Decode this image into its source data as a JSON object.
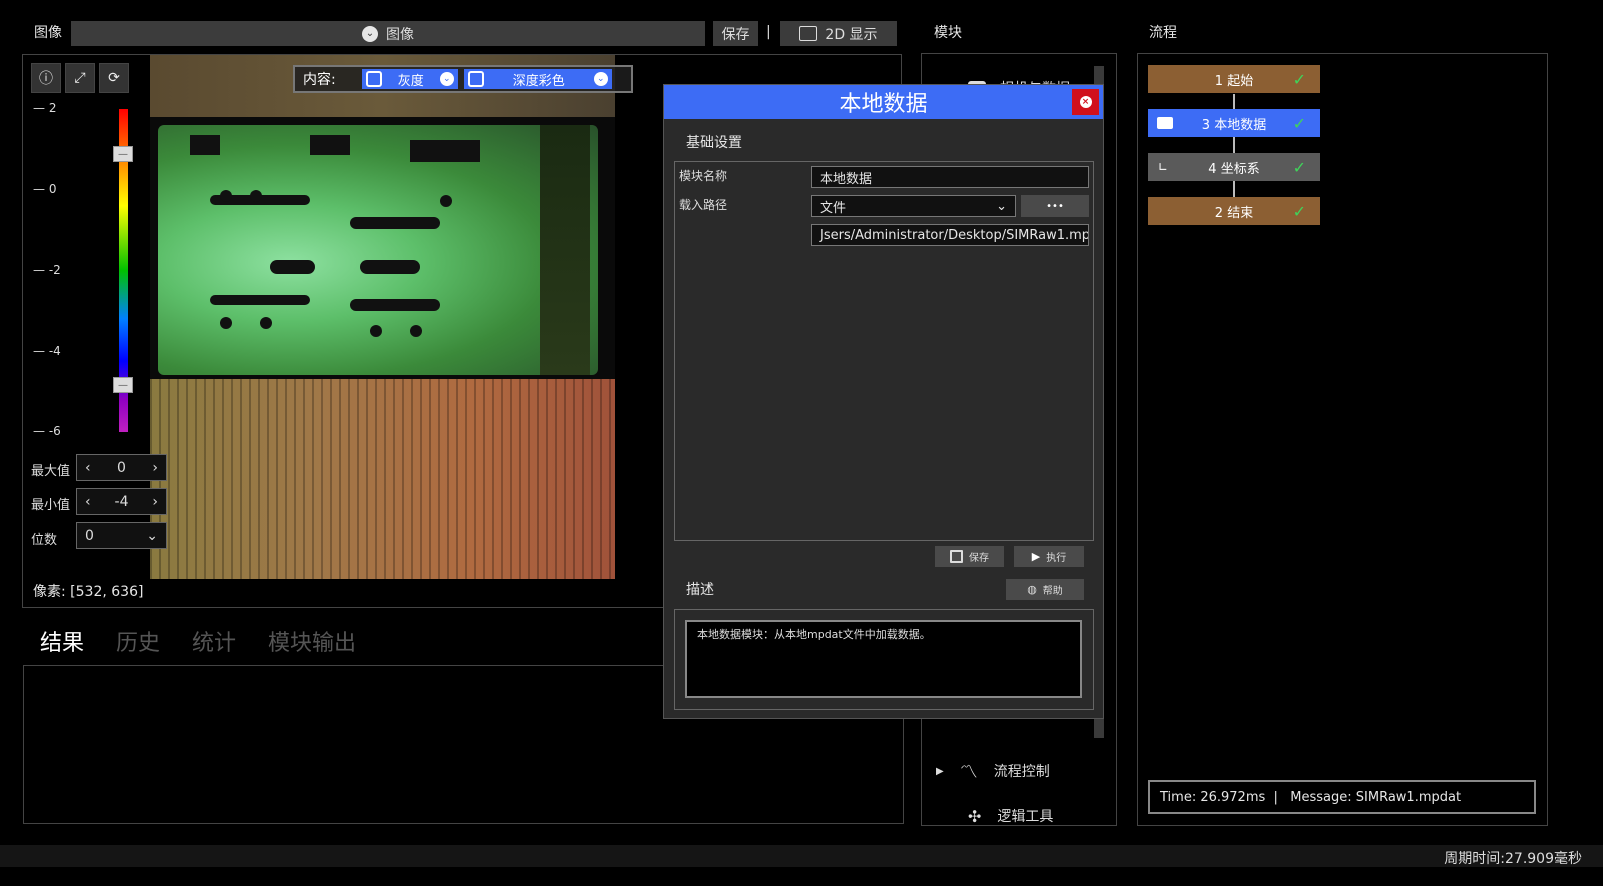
{
  "image_panel": {
    "title": "图像",
    "selector_value": "图像",
    "save_label": "保存",
    "separator": "|",
    "display_label": "2D 显示",
    "content_label": "内容:",
    "gray_label": "灰度",
    "depth_color_label": "深度彩色",
    "scale_ticks": [
      "2",
      "0",
      "-2",
      "-4",
      "-6"
    ],
    "max_label": "最大值",
    "max_value": "0",
    "min_label": "最小值",
    "min_value": "-4",
    "digits_label": "位数",
    "digits_value": "0",
    "pixel_readout": "像素: [532, 636]"
  },
  "result_tabs": [
    "结果",
    "历史",
    "统计",
    "模块输出"
  ],
  "module_panel": {
    "title": "模块",
    "partial_item": "相机与数据",
    "items": [
      {
        "label": "流程控制",
        "icon": "trend-icon"
      },
      {
        "label": "逻辑工具",
        "icon": "logic-icon"
      }
    ]
  },
  "flow_panel": {
    "title": "流程",
    "steps": [
      {
        "label": "1 起始",
        "color": "#8c5f33"
      },
      {
        "label": "3 本地数据",
        "color": "#3d6cf5"
      },
      {
        "label": "4 坐标系",
        "color": "#5a5a5a"
      },
      {
        "label": "2 结束",
        "color": "#8c5f33"
      }
    ],
    "status": "Time: 26.972ms  |   Message: SIMRaw1.mpdat"
  },
  "dialog": {
    "title": "本地数据",
    "section_basic": "基础设置",
    "name_label": "模块名称",
    "name_value": "本地数据",
    "path_label": "载入路径",
    "path_type": "文件",
    "browse_label": "•••",
    "path_value": "Jsers/Administrator/Desktop/SIMRaw1.mpdat",
    "save_label": "保存",
    "run_label": "执行",
    "section_desc": "描述",
    "help_label": "帮助",
    "description": "本地数据模块：从本地mpdat文件中加载数据。"
  },
  "footer": {
    "cycle_time": "周期时间:27.909毫秒"
  },
  "colors": {
    "accent": "#3d6cf5",
    "flow_brown": "#8c5f33",
    "close_red": "#d0101c",
    "check_green": "#3fd45a"
  }
}
